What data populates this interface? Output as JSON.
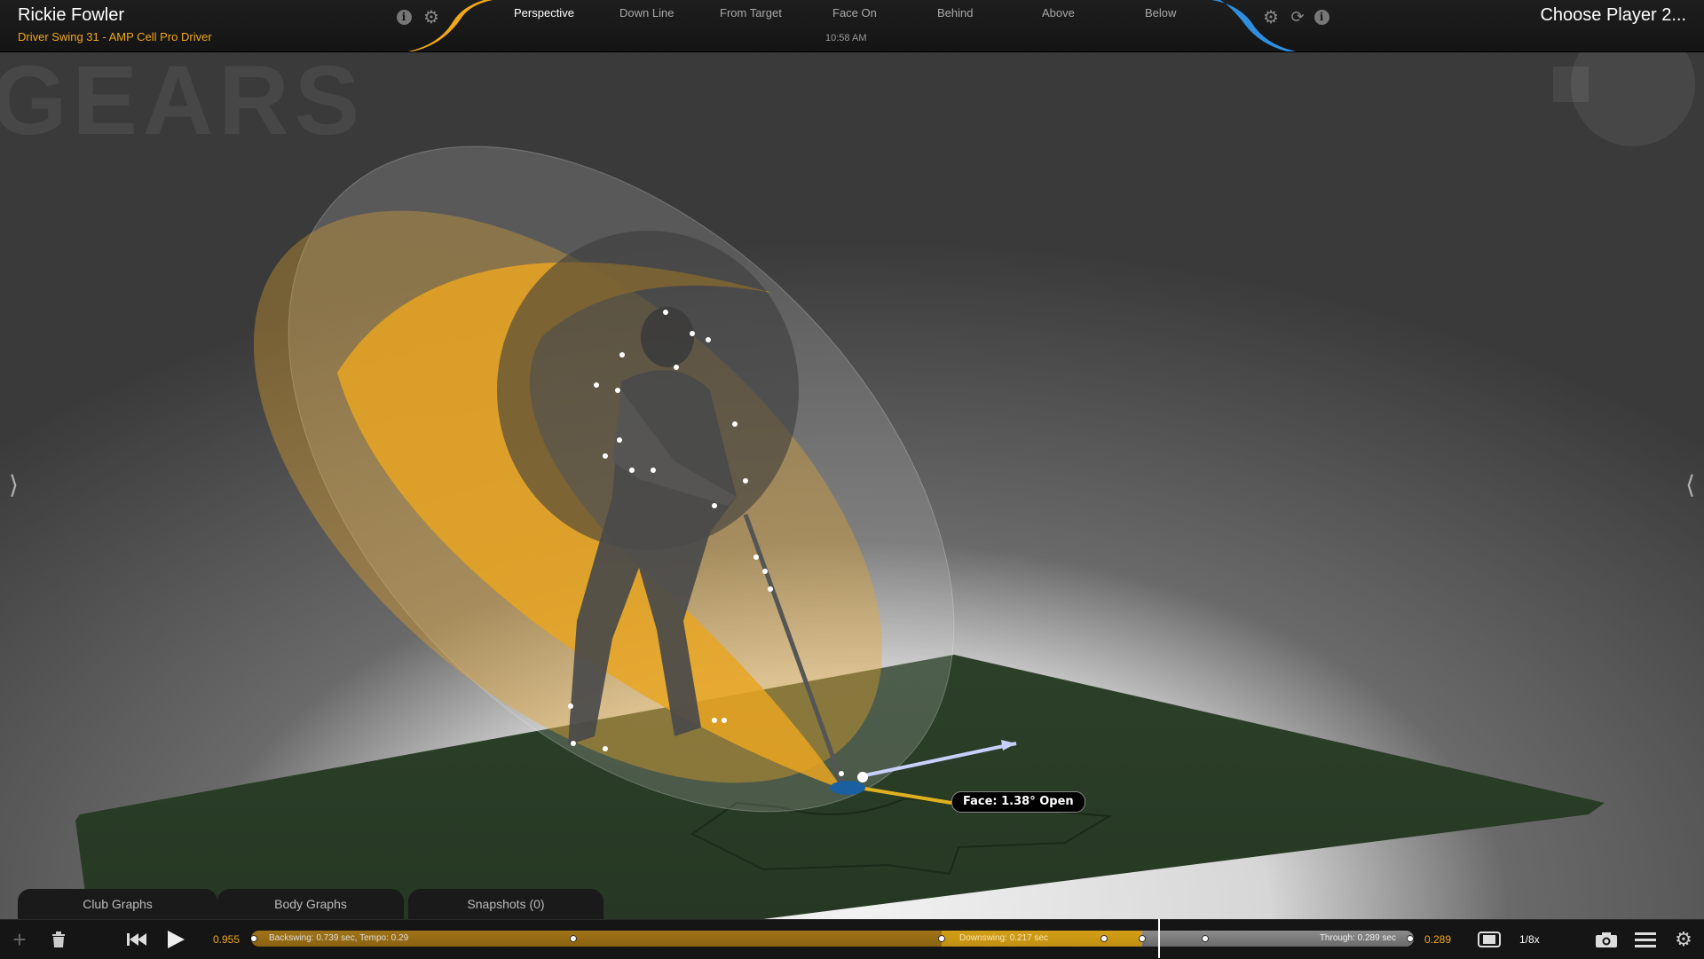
{
  "header": {
    "player_name": "Rickie Fowler",
    "subtitle": "Driver Swing 31 - AMP Cell Pro Driver",
    "time": "10:58 AM",
    "choose_player": "Choose Player 2...",
    "tabs": [
      {
        "label": "Perspective",
        "active": true
      },
      {
        "label": "Down Line",
        "active": false
      },
      {
        "label": "From Target",
        "active": false
      },
      {
        "label": "Face On",
        "active": false
      },
      {
        "label": "Behind",
        "active": false
      },
      {
        "label": "Above",
        "active": false
      },
      {
        "label": "Below",
        "active": false
      }
    ],
    "left_icons": [
      "info-icon",
      "gear-icon"
    ],
    "right_icons": [
      "gear-icon",
      "refresh-icon",
      "info-icon"
    ],
    "accent_left": "#f0a818",
    "accent_right": "#2e8fe0"
  },
  "viewport": {
    "watermark": "GEARS",
    "face_readout": "Face: 1.38° Open",
    "left_arrow": "⟩",
    "right_arrow": "⟨",
    "mat_color": "#2f4a2e",
    "swing_color": "#f0a818"
  },
  "bottom_tabs": [
    {
      "label": "Club Graphs"
    },
    {
      "label": "Body Graphs"
    },
    {
      "label": "Snapshots (0)"
    }
  ],
  "timeline": {
    "start_value": "0.955",
    "end_value": "0.289",
    "backswing_label": "Backswing: 0.739 sec, Tempo: 0.29",
    "downswing_label": "Downswing: 0.217 sec",
    "through_label": "Through: 0.289 sec",
    "playhead_fraction": 0.78,
    "speed": "1/8x"
  },
  "toolbar_icons": [
    "add-icon",
    "trash-icon",
    "skip-back-icon",
    "play-icon",
    "fullscreen-icon",
    "camera-icon",
    "menu-icon",
    "settings-icon"
  ]
}
